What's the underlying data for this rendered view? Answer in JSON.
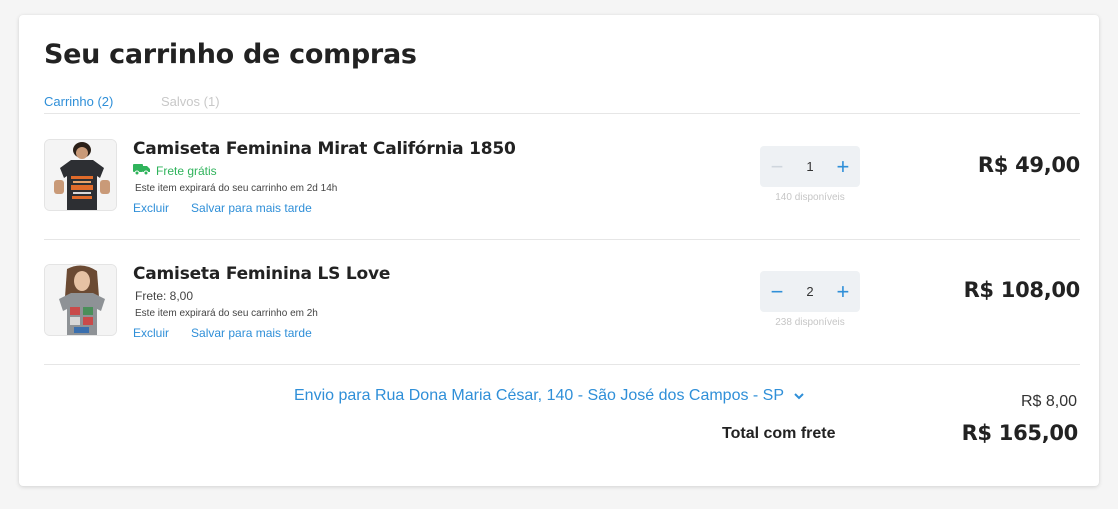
{
  "page": {
    "title": "Seu carrinho de compras"
  },
  "tabs": [
    {
      "label": "Carrinho (2)",
      "active": true
    },
    {
      "label": "Salvos (1)",
      "active": false
    }
  ],
  "items": [
    {
      "name": "Camiseta Feminina Mirat Califórnia 1850",
      "shipping": "Frete grátis",
      "shipping_icon": "truck-icon",
      "expiry": "Este item expirará do seu carrinho em 2d 14h",
      "delete_label": "Excluir",
      "save_label": "Salvar para mais tarde",
      "quantity": "1",
      "available": "140 disponíveis",
      "price": "R$ 49,00"
    },
    {
      "name": "Camiseta Feminina LS Love",
      "shipping": "Frete: 8,00",
      "expiry": "Este item expirará do seu carrinho em 2h",
      "delete_label": "Excluir",
      "save_label": "Salvar para mais tarde",
      "quantity": "2",
      "available": "238 disponíveis",
      "price": "R$ 108,00"
    }
  ],
  "summary": {
    "ship_to": "Envio para Rua Dona Maria César, 140 - São José dos Campos - SP",
    "ship_cost": "R$ 8,00",
    "total_label": "Total com frete",
    "total_value": "R$ 165,00"
  },
  "colors": {
    "accent": "#2f8fd8",
    "free_shipping": "#2fb35b",
    "text": "#222222",
    "muted": "#c6c6c6"
  }
}
